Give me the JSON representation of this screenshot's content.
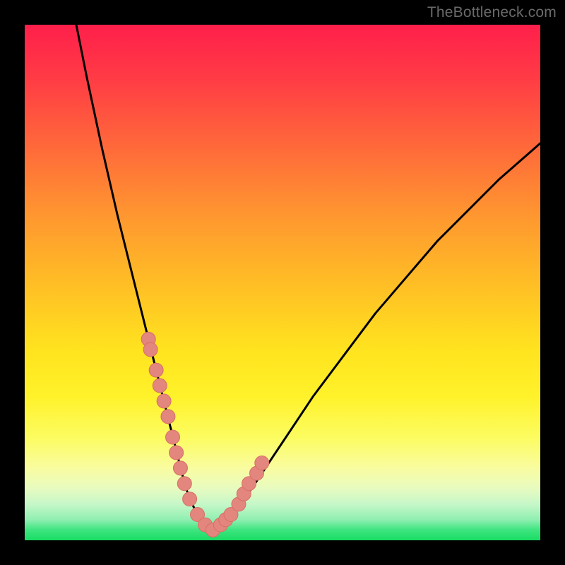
{
  "watermark": "TheBottleneck.com",
  "colors": {
    "frame": "#000000",
    "curve": "#000000",
    "marker_fill": "#e2867e",
    "marker_stroke": "#d86f66",
    "gradient_top": "#ff1f4b",
    "gradient_bottom": "#18dc64"
  },
  "chart_data": {
    "type": "line",
    "title": "",
    "xlabel": "",
    "ylabel": "",
    "xlim": [
      0,
      100
    ],
    "ylim": [
      0,
      100
    ],
    "series": [
      {
        "name": "bottleneck-curve",
        "x": [
          10,
          12,
          15,
          18,
          20,
          22,
          24,
          25.5,
          27,
          28.5,
          30,
          31,
          32,
          33.5,
          35,
          37,
          39,
          41,
          44,
          48,
          52,
          56,
          62,
          68,
          74,
          80,
          86,
          92,
          100
        ],
        "y": [
          100,
          90,
          76,
          63,
          55,
          47,
          39,
          33,
          27,
          21,
          15,
          11,
          8,
          5,
          3,
          2,
          3,
          6,
          10,
          16,
          22,
          28,
          36,
          44,
          51,
          58,
          64,
          70,
          77
        ]
      }
    ],
    "markers": {
      "name": "highlight-points",
      "x": [
        24.0,
        24.4,
        25.5,
        26.2,
        27.0,
        27.8,
        28.7,
        29.4,
        30.2,
        31.0,
        32.0,
        33.5,
        35.0,
        36.5,
        38.0,
        39.0,
        40.0,
        41.5,
        42.5,
        43.5,
        45.0,
        46.0
      ],
      "y": [
        39,
        37,
        33,
        30,
        27,
        24,
        20,
        17,
        14,
        11,
        8,
        5,
        3,
        2,
        3,
        4,
        5,
        7,
        9,
        11,
        13,
        15
      ]
    }
  }
}
